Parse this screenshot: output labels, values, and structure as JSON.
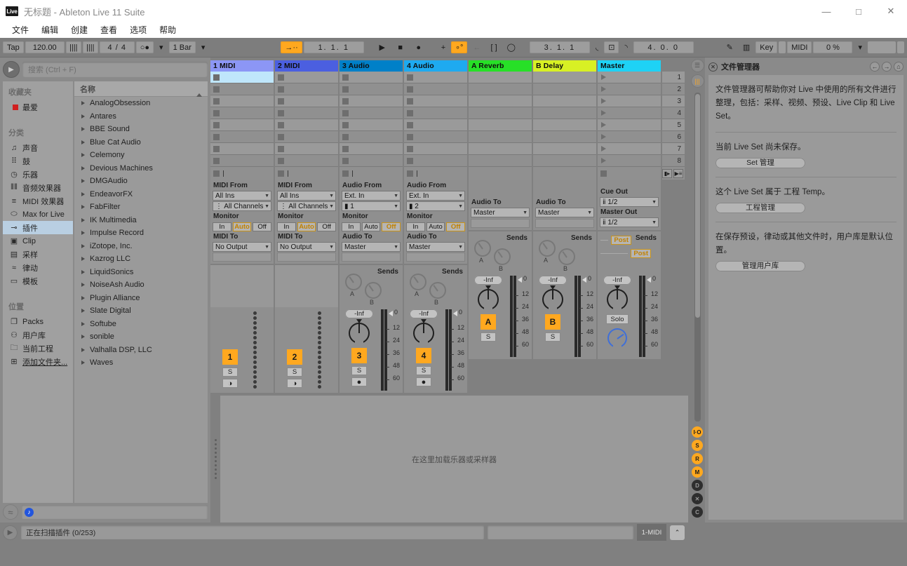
{
  "window": {
    "logo": "Live",
    "title": "无标题 - Ableton Live 11 Suite",
    "minimize": "—",
    "maximize": "□",
    "close": "✕"
  },
  "menubar": {
    "items": [
      "文件",
      "编辑",
      "创建",
      "查看",
      "选项",
      "帮助"
    ]
  },
  "controlbar": {
    "tap": "Tap",
    "tempo": "120.00",
    "metronome_icon": "|||| ",
    "nudge_icon": "||||",
    "time_signature": "4 / 4",
    "quantize_icon": "○●",
    "quantize_caret": "▾",
    "launch_quantize": "1 Bar",
    "launch_caret": "▾",
    "follow_icon": "→··",
    "arrangement_position": "1.  1.  1",
    "play_icon": "▶",
    "stop_icon": "■",
    "record_icon": "●",
    "new_icon": "+",
    "session_record_icon": "∘°",
    "back_icon": "←",
    "loop_brackets_icon": "[ ]",
    "capture_icon": "◯",
    "loop_start": "3.  1.  1",
    "punch_in_icon": "◟",
    "loop_switch_icon": "⊡",
    "punch_out_icon": "◝",
    "loop_length": "4.  0.  0",
    "draw_icon": "✎",
    "keyboard_icon": "▥",
    "key_label": "Key",
    "midi_label": "MIDI",
    "cpu_load": "0 %",
    "cpu_caret": "▾"
  },
  "browser": {
    "search_placeholder": "搜索 (Ctrl + F)",
    "favorites_header": "收藏夹",
    "favorites": [
      {
        "label": "最爱",
        "icon": "red-square-icon"
      }
    ],
    "categories_header": "分类",
    "categories": [
      {
        "label": "声音",
        "icon": "sounds-icon"
      },
      {
        "label": "鼓",
        "icon": "drums-icon"
      },
      {
        "label": "乐器",
        "icon": "instruments-icon"
      },
      {
        "label": "音频效果器",
        "icon": "audio-effects-icon"
      },
      {
        "label": "MIDI 效果器",
        "icon": "midi-effects-icon"
      },
      {
        "label": "Max for Live",
        "icon": "max-for-live-icon"
      },
      {
        "label": "插件",
        "icon": "plugins-icon",
        "selected": true
      },
      {
        "label": "Clip",
        "icon": "clip-icon"
      },
      {
        "label": "采样",
        "icon": "samples-icon"
      },
      {
        "label": "律动",
        "icon": "grooves-icon"
      },
      {
        "label": "模板",
        "icon": "templates-icon"
      }
    ],
    "places_header": "位置",
    "places": [
      {
        "label": "Packs",
        "icon": "packs-icon"
      },
      {
        "label": "用户库",
        "icon": "user-library-icon"
      },
      {
        "label": "当前工程",
        "icon": "current-project-icon"
      },
      {
        "label": "添加文件夹...",
        "icon": "add-folder-icon",
        "underline": true
      }
    ],
    "column_header": "名称",
    "sort_arrow": "▲",
    "plugins": [
      "AnalogObsession",
      "Antares",
      "BBE Sound",
      "Blue Cat Audio",
      "Celemony",
      "Devious Machines",
      "DMGAudio",
      "EndeavorFX",
      "FabFilter",
      "IK Multimedia",
      "Impulse Record",
      "iZotope, Inc.",
      "Kazrog LLC",
      "LiquidSonics",
      "NoiseAsh Audio",
      "Plugin Alliance",
      "Slate Digital",
      "Softube",
      "sonible",
      "Valhalla DSP, LLC",
      "Waves"
    ]
  },
  "session": {
    "tracks": [
      {
        "name": "1 MIDI",
        "color": "#8c96f5",
        "type": "midi",
        "io": {
          "from_label": "MIDI From",
          "from_value": "All Ins",
          "channel_value": "All Channels",
          "monitor_label": "Monitor",
          "monitor": [
            "In",
            "Auto",
            "Off"
          ],
          "monitor_active": "Auto",
          "to_label": "MIDI To",
          "to_value": "No Output"
        },
        "mixer": {
          "button": "1",
          "solo": "S",
          "arm": "◑",
          "has_volume": false
        }
      },
      {
        "name": "2 MIDI",
        "color": "#4b5fe0",
        "type": "midi",
        "io": {
          "from_label": "MIDI From",
          "from_value": "All Ins",
          "channel_value": "All Channels",
          "monitor_label": "Monitor",
          "monitor": [
            "In",
            "Auto",
            "Off"
          ],
          "monitor_active": "Auto",
          "to_label": "MIDI To",
          "to_value": "No Output"
        },
        "mixer": {
          "button": "2",
          "solo": "S",
          "arm": "◑",
          "has_volume": false
        }
      },
      {
        "name": "3 Audio",
        "color": "#0080c8",
        "type": "audio",
        "io": {
          "from_label": "Audio From",
          "from_value": "Ext. In",
          "channel_value": "1",
          "monitor_label": "Monitor",
          "monitor": [
            "In",
            "Auto",
            "Off"
          ],
          "monitor_active": "Off",
          "to_label": "Audio To",
          "to_value": "Master"
        },
        "mixer": {
          "volume": "-Inf",
          "button": "3",
          "solo": "S",
          "arm": "●",
          "has_volume": true
        },
        "sends": {
          "label": "Sends",
          "knobs": [
            "A",
            "B"
          ]
        }
      },
      {
        "name": "4 Audio",
        "color": "#1eaaf0",
        "type": "audio",
        "io": {
          "from_label": "Audio From",
          "from_value": "Ext. In",
          "channel_value": "2",
          "monitor_label": "Monitor",
          "monitor": [
            "In",
            "Auto",
            "Off"
          ],
          "monitor_active": "Off",
          "to_label": "Audio To",
          "to_value": "Master"
        },
        "mixer": {
          "volume": "-Inf",
          "button": "4",
          "solo": "S",
          "arm": "●",
          "has_volume": true
        },
        "sends": {
          "label": "Sends",
          "knobs": [
            "A",
            "B"
          ]
        }
      }
    ],
    "returns": [
      {
        "name": "A Reverb",
        "color": "#27e027",
        "io": {
          "to_label": "Audio To",
          "to_value": "Master"
        },
        "mixer": {
          "volume": "-Inf",
          "button": "A",
          "solo": "S"
        },
        "sends": {
          "label": "Sends",
          "knobs": [
            "A",
            "B"
          ]
        }
      },
      {
        "name": "B Delay",
        "color": "#d8f024",
        "io": {
          "to_label": "Audio To",
          "to_value": "Master"
        },
        "mixer": {
          "volume": "-Inf",
          "button": "B",
          "solo": "S"
        },
        "sends": {
          "label": "Sends",
          "knobs": [
            "A",
            "B"
          ]
        }
      }
    ],
    "master": {
      "name": "Master",
      "color": "#1ed2f5",
      "cue_out_label": "Cue Out",
      "cue_out_value": "1/2",
      "master_out_label": "Master Out",
      "master_out_value": "1/2",
      "sends_label": "Sends",
      "post_a": "Post",
      "post_b": "Post",
      "mixer": {
        "volume": "-Inf",
        "solo": "Solo"
      }
    },
    "scene_numbers": [
      "1",
      "2",
      "3",
      "4",
      "5",
      "6",
      "7",
      "8"
    ],
    "scene_stop_icon": "▮▸",
    "scene_launch_icon": "▶≡",
    "meter_scale": [
      "0",
      "12",
      "24",
      "36",
      "48",
      "60"
    ],
    "strip_buttons": [
      {
        "name": "io-toggle",
        "label": "I·O",
        "state": "on"
      },
      {
        "name": "sends-toggle",
        "label": "S",
        "state": "on"
      },
      {
        "name": "returns-toggle",
        "label": "R",
        "state": "on"
      },
      {
        "name": "mixer-toggle",
        "label": "M",
        "state": "on"
      },
      {
        "name": "delay-toggle",
        "label": "D",
        "state": "off"
      },
      {
        "name": "crossfade-toggle",
        "label": "✕",
        "state": "off"
      },
      {
        "name": "crossfader-toggle",
        "label": "C",
        "state": "off"
      }
    ],
    "top_strip_buttons": [
      {
        "name": "session-view-icon",
        "label": "☰"
      },
      {
        "name": "arrangement-view-icon",
        "label": "|||"
      }
    ]
  },
  "device_area": {
    "drop_hint": "在这里加载乐器或采样器"
  },
  "help_panel": {
    "title": "文件管理器",
    "close_icon": "✕",
    "nav_back": "←",
    "nav_forward": "→",
    "nav_home": "⌂",
    "paragraphs": [
      "文件管理器可帮助你对 Live 中使用的所有文件进行整理，包括：采样、视频、预设、Live Clip 和 Live Set。",
      "当前 Live Set 尚未保存。",
      "这个 Live Set 属于 工程 Temp。",
      "在保存预设，律动或其他文件时，用户库是默认位置。"
    ],
    "buttons": [
      "Set 管理",
      "工程管理",
      "管理用户库"
    ],
    "project_link": "工程"
  },
  "statusbar": {
    "play_icon": "▶",
    "message": "正在扫描插件 (0/253)",
    "secondary": "",
    "midi_indicator": "1-MIDI",
    "expand_icon": "⌃"
  }
}
